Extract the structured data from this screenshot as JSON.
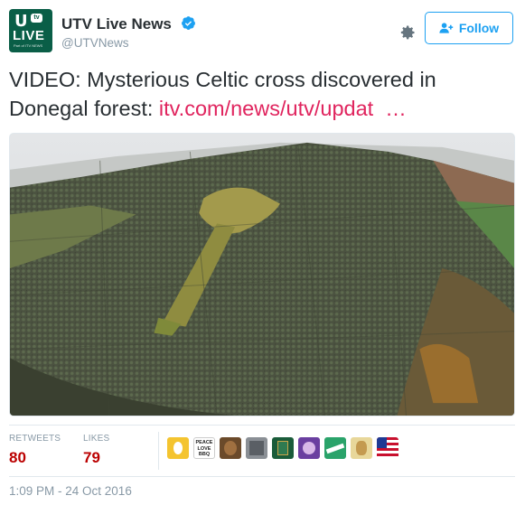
{
  "account": {
    "avatar_text_main": "LIVE",
    "avatar_text_u": "U",
    "avatar_text_tv": "tv",
    "avatar_text_sub": "Part of ITV NEWS",
    "name": "UTV Live News",
    "handle": "@UTVNews",
    "verified": true,
    "verified_icon": "verified-badge-icon"
  },
  "actions": {
    "settings_icon": "gear-icon",
    "follow_label": "Follow",
    "follow_icon": "add-user-icon"
  },
  "tweet": {
    "text": "VIDEO: Mysterious Celtic cross discovered in Donegal forest: ",
    "link_text": "itv.com/news/utv/updat",
    "ellipsis": "…",
    "link_color": "#e0245e"
  },
  "media": {
    "description_icon": "aerial-forest-photo"
  },
  "stats": {
    "retweets_label": "RETWEETS",
    "retweets_value": "80",
    "likes_label": "LIKES",
    "likes_value": "79",
    "likers_count": 9,
    "peace_text": "PEACE LOVE BBQ"
  },
  "timestamp": "1:09 PM - 24 Oct 2016",
  "colors": {
    "brand_green": "#0a5e47",
    "follow_blue": "#1da1f2",
    "stat_value": "#bb0000",
    "muted": "#8899a6"
  }
}
